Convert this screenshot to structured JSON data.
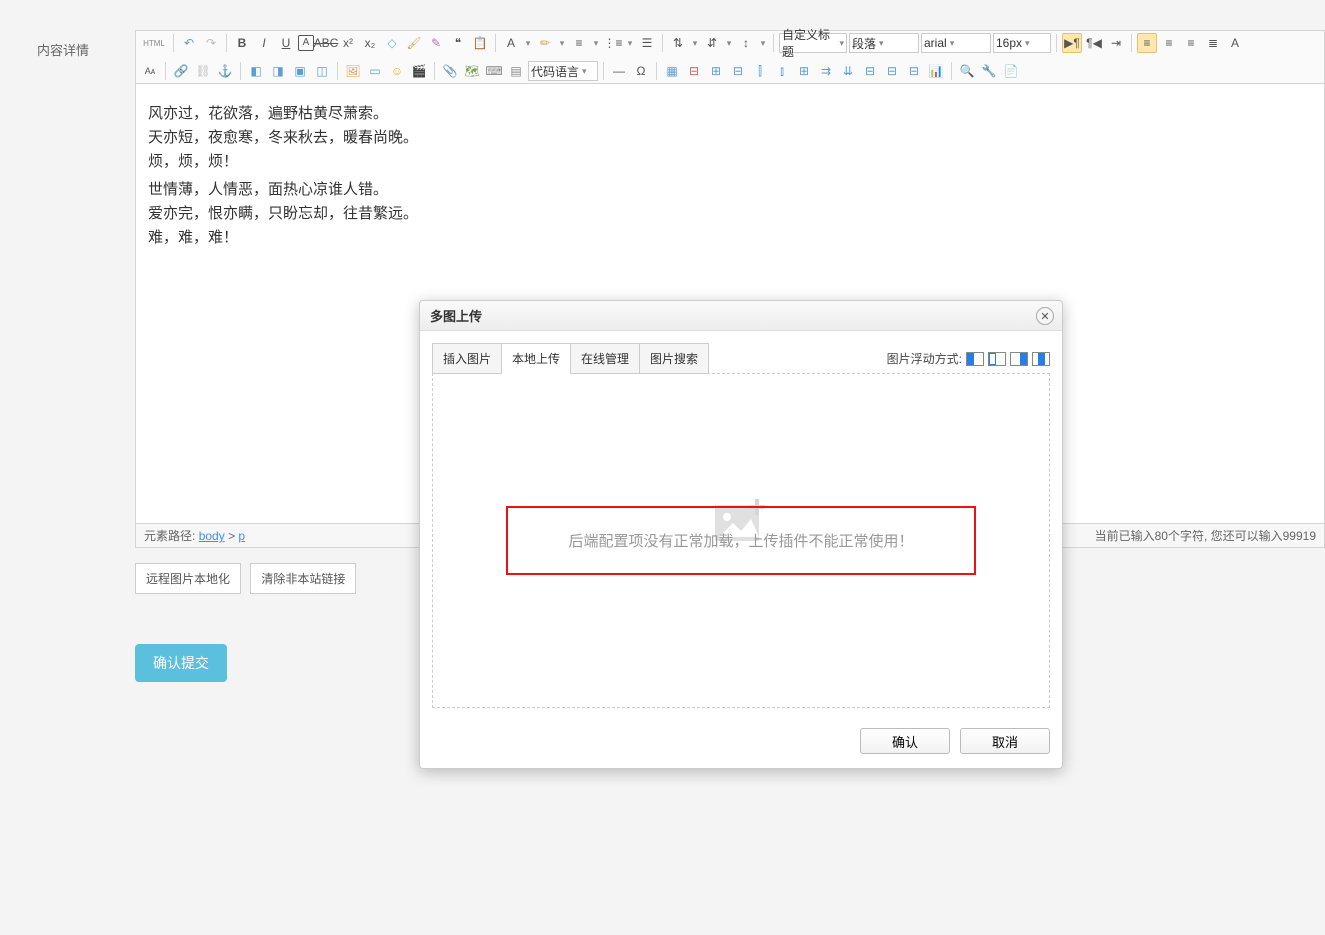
{
  "labels": {
    "contentDetail": "内容详情"
  },
  "toolbar": {
    "html": "HTML",
    "headingSelect": "自定义标题",
    "paraSelect": "段落",
    "fontSelect": "arial",
    "sizeSelect": "16px",
    "codeLangSelect": "代码语言"
  },
  "content": {
    "lines": [
      "风亦过，花欲落，遍野枯黄尽萧索。",
      "天亦短，夜愈寒，冬来秋去，暖春尚晚。",
      "烦，烦，烦！",
      "世情薄，人情恶，面热心凉谁人错。",
      "爱亦完，恨亦瞒，只盼忘却，往昔繁远。",
      "难，难，难！"
    ]
  },
  "footer": {
    "pathLabel": "元素路径:",
    "pathBody": "body",
    "pathSep": ">",
    "pathP": "p",
    "countPrefix": "当前已输入",
    "countNum": "80",
    "countMid": "个字符, 您还可以输入",
    "countRemain": "99919"
  },
  "buttons": {
    "remoteLocal": "远程图片本地化",
    "clearLinks": "清除非本站链接",
    "submit": "确认提交"
  },
  "dialog": {
    "title": "多图上传",
    "tabs": {
      "insert": "插入图片",
      "local": "本地上传",
      "online": "在线管理",
      "search": "图片搜索"
    },
    "floatLabel": "图片浮动方式:",
    "errorMsg": "后端配置项没有正常加载，上传插件不能正常使用！",
    "ok": "确认",
    "cancel": "取消"
  }
}
